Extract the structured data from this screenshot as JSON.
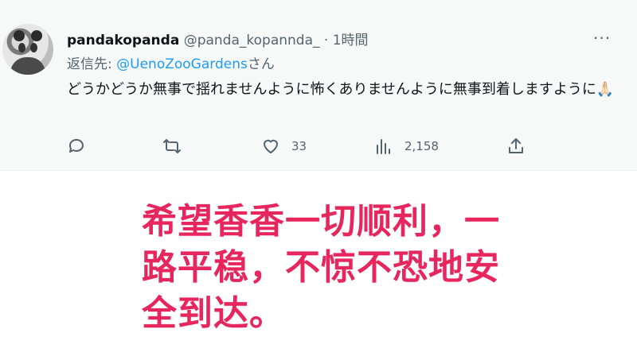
{
  "tweet": {
    "display_name": "pandakopanda",
    "handle": "@panda_kopannda_",
    "separator": "·",
    "time": "1時間",
    "more_icon": "more-horizontal-icon",
    "reply_prefix": "返信先: ",
    "reply_mention": "@UenoZooGardens",
    "reply_suffix": "さん",
    "text": "どうかどうか無事で揺れませんように怖くありませんように無事到着しますように🙏🏻",
    "actions": {
      "reply": {
        "icon": "reply-icon",
        "count": ""
      },
      "retweet": {
        "icon": "retweet-icon",
        "count": ""
      },
      "like": {
        "icon": "heart-icon",
        "count": "33"
      },
      "views": {
        "icon": "views-icon",
        "count": "2,158"
      },
      "share": {
        "icon": "share-icon",
        "count": ""
      }
    }
  },
  "caption": "希望香香一切顺利，一路平稳，不惊不恐地安全到达。",
  "colors": {
    "caption": "#e8265e",
    "mention": "#1d9bf0",
    "muted": "#536471",
    "tweet_bg": "#f7f9f9"
  }
}
